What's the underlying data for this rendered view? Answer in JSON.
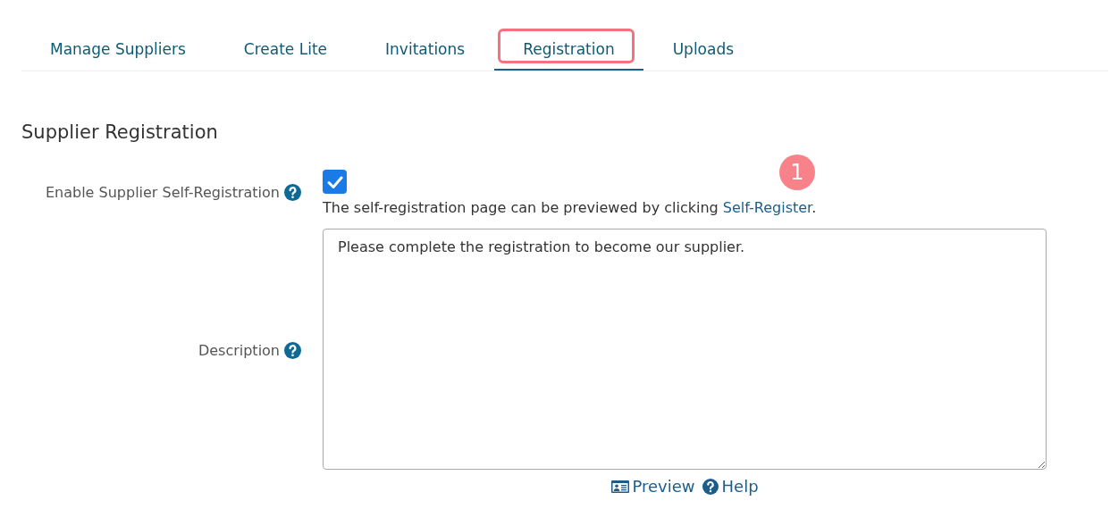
{
  "tabs": [
    {
      "label": "Manage Suppliers",
      "selected": false,
      "highlighted": false
    },
    {
      "label": "Create Lite",
      "selected": false,
      "highlighted": false
    },
    {
      "label": "Invitations",
      "selected": false,
      "highlighted": false
    },
    {
      "label": "Registration",
      "selected": true,
      "highlighted": true
    },
    {
      "label": "Uploads",
      "selected": false,
      "highlighted": false
    }
  ],
  "heading": "Supplier Registration",
  "self_registration": {
    "label": "Enable Supplier Self-Registration",
    "checked": true,
    "note": "The self-registration page can be previewed by clicking ",
    "link": "Self-Register",
    "note_end": ".",
    "callout": "1"
  },
  "description": {
    "label": "Description",
    "value": "Please complete the registration to become our supplier."
  },
  "actions": [
    {
      "kind": "preview",
      "label": "Preview"
    },
    {
      "kind": "help",
      "label": "Help"
    }
  ]
}
